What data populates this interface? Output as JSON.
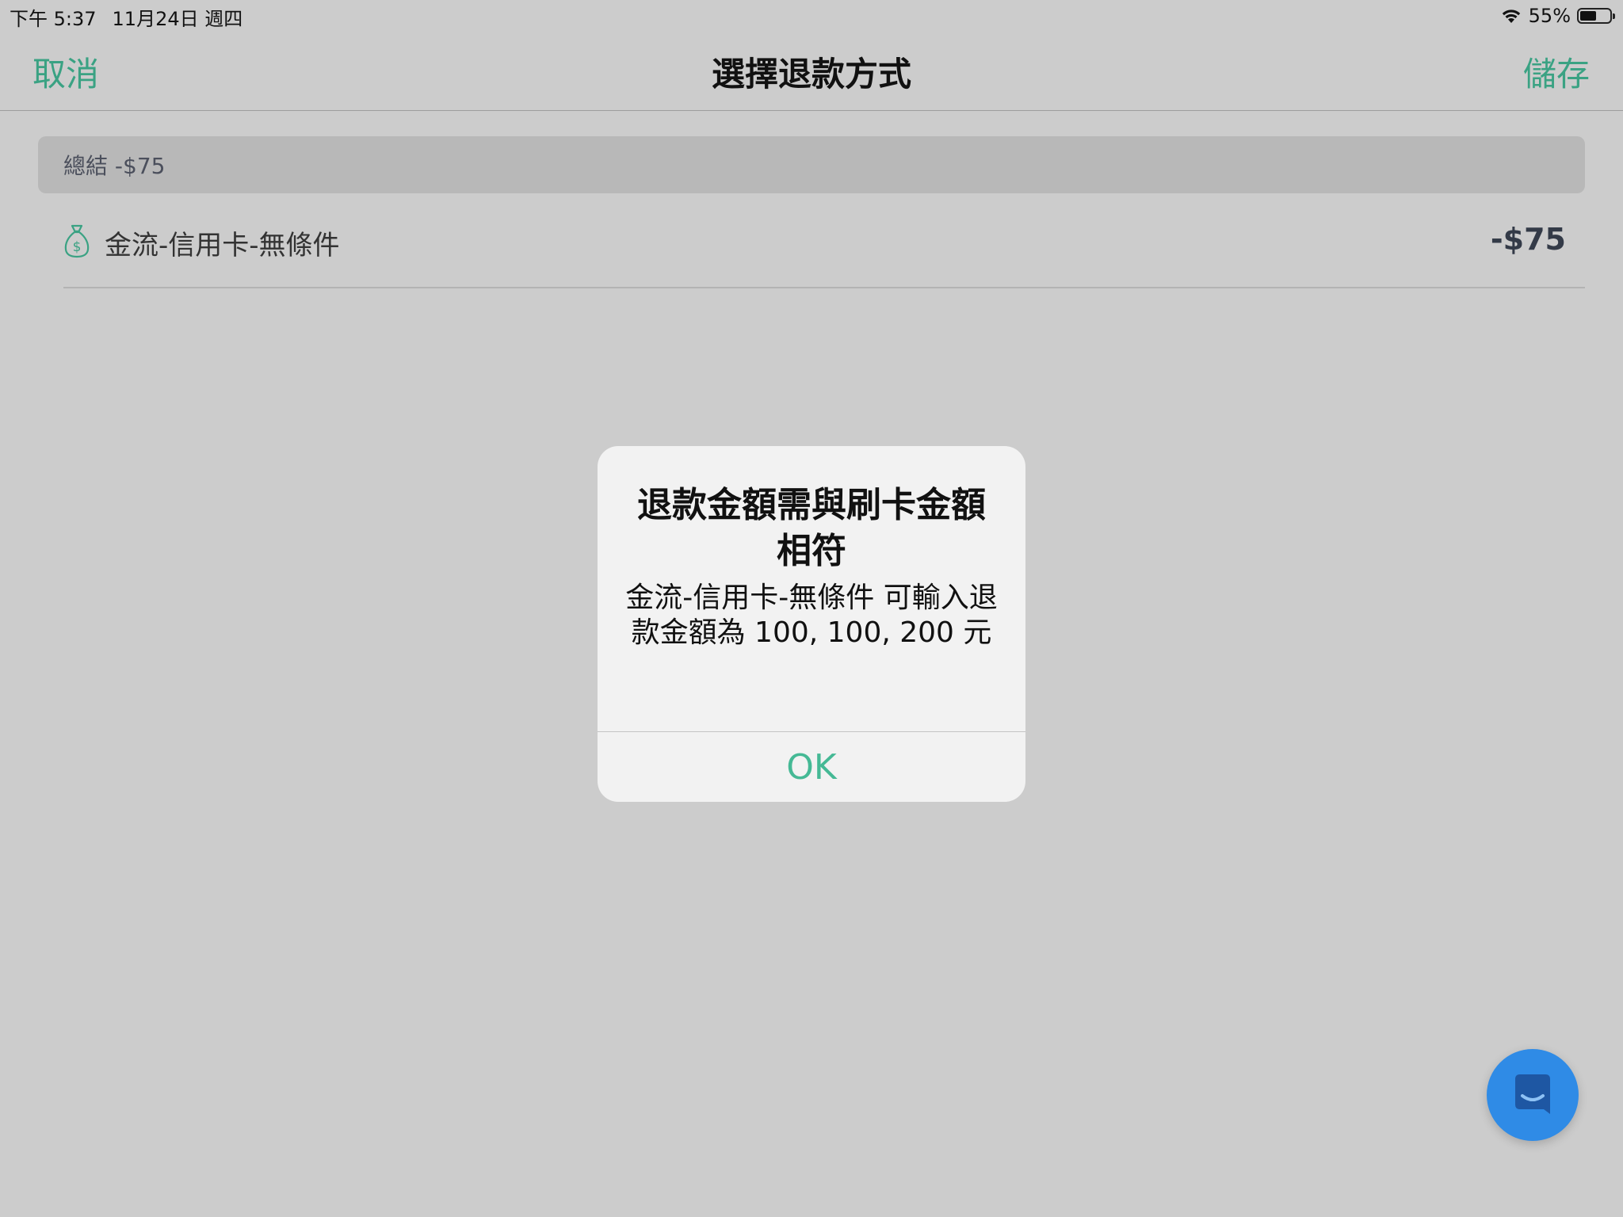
{
  "status_bar": {
    "time": "下午 5:37",
    "date": "11月24日 週四",
    "battery_percent": "55%",
    "battery_level": 0.55
  },
  "nav": {
    "cancel_label": "取消",
    "title": "選擇退款方式",
    "save_label": "儲存"
  },
  "summary": {
    "label": "總結 -$75"
  },
  "payment_method": {
    "icon": "money-bag-icon",
    "label": "金流-信用卡-無條件",
    "amount": "-$75"
  },
  "alert": {
    "title": "退款金額需與刷卡金額相符",
    "message": "金流-信用卡-無條件 可輸入退款金額為 100, 100, 200 元",
    "ok_label": "OK"
  },
  "chat": {
    "icon": "chat-icon"
  },
  "colors": {
    "accent": "#3aa283",
    "alert_button": "#45b995",
    "chat": "#2f8be6",
    "background": "#cccccc"
  }
}
